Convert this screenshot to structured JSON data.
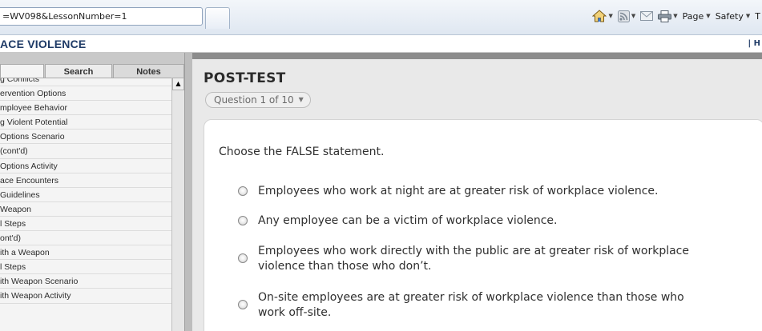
{
  "browser": {
    "address": "=WV098&LessonNumber=1",
    "commands": [
      "Page",
      "Safety",
      "T"
    ]
  },
  "course": {
    "title": "ACE VIOLENCE",
    "help_link": "H"
  },
  "sidebar": {
    "tabs": {
      "search": "Search",
      "notes": "Notes"
    },
    "items": [
      "g Conflicts",
      "ervention Options",
      "mployee Behavior",
      "g Violent Potential",
      "Options Scenario",
      "(cont'd)",
      "Options Activity",
      "ace Encounters",
      "Guidelines",
      "Weapon",
      "l Steps",
      "ont'd)",
      "ith a Weapon",
      "l Steps",
      "ith Weapon Scenario",
      "ith Weapon Activity"
    ]
  },
  "main": {
    "title": "POST-TEST",
    "question_progress": "Question 1 of 10",
    "prompt": "Choose the FALSE statement.",
    "options": [
      "Employees who work at night are at greater risk of workplace violence.",
      "Any employee can be a victim of workplace violence.",
      "Employees who work directly with the public are at greater risk of workplace violence than those who don’t.",
      "On-site employees are at greater risk of workplace violence than those who work off-site."
    ]
  },
  "icons": [
    "home-icon",
    "feeds-icon",
    "mail-icon",
    "print-icon",
    "dropdown-caret-icon",
    "scroll-up-icon"
  ]
}
